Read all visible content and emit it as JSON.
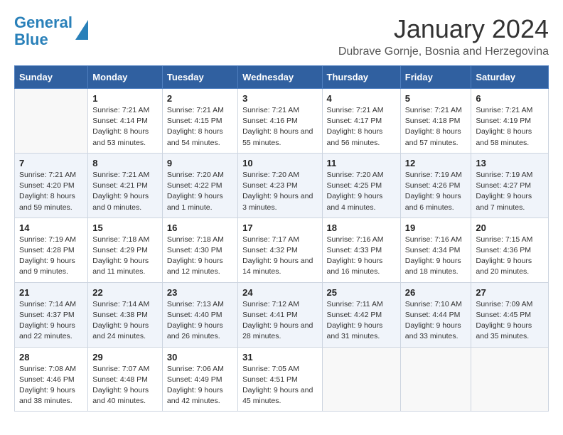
{
  "logo": {
    "line1": "General",
    "line2": "Blue"
  },
  "title": "January 2024",
  "location": "Dubrave Gornje, Bosnia and Herzegovina",
  "days_of_week": [
    "Sunday",
    "Monday",
    "Tuesday",
    "Wednesday",
    "Thursday",
    "Friday",
    "Saturday"
  ],
  "weeks": [
    [
      {
        "day": "",
        "sunrise": "",
        "sunset": "",
        "daylight": ""
      },
      {
        "day": "1",
        "sunrise": "Sunrise: 7:21 AM",
        "sunset": "Sunset: 4:14 PM",
        "daylight": "Daylight: 8 hours and 53 minutes."
      },
      {
        "day": "2",
        "sunrise": "Sunrise: 7:21 AM",
        "sunset": "Sunset: 4:15 PM",
        "daylight": "Daylight: 8 hours and 54 minutes."
      },
      {
        "day": "3",
        "sunrise": "Sunrise: 7:21 AM",
        "sunset": "Sunset: 4:16 PM",
        "daylight": "Daylight: 8 hours and 55 minutes."
      },
      {
        "day": "4",
        "sunrise": "Sunrise: 7:21 AM",
        "sunset": "Sunset: 4:17 PM",
        "daylight": "Daylight: 8 hours and 56 minutes."
      },
      {
        "day": "5",
        "sunrise": "Sunrise: 7:21 AM",
        "sunset": "Sunset: 4:18 PM",
        "daylight": "Daylight: 8 hours and 57 minutes."
      },
      {
        "day": "6",
        "sunrise": "Sunrise: 7:21 AM",
        "sunset": "Sunset: 4:19 PM",
        "daylight": "Daylight: 8 hours and 58 minutes."
      }
    ],
    [
      {
        "day": "7",
        "sunrise": "Sunrise: 7:21 AM",
        "sunset": "Sunset: 4:20 PM",
        "daylight": "Daylight: 8 hours and 59 minutes."
      },
      {
        "day": "8",
        "sunrise": "Sunrise: 7:21 AM",
        "sunset": "Sunset: 4:21 PM",
        "daylight": "Daylight: 9 hours and 0 minutes."
      },
      {
        "day": "9",
        "sunrise": "Sunrise: 7:20 AM",
        "sunset": "Sunset: 4:22 PM",
        "daylight": "Daylight: 9 hours and 1 minute."
      },
      {
        "day": "10",
        "sunrise": "Sunrise: 7:20 AM",
        "sunset": "Sunset: 4:23 PM",
        "daylight": "Daylight: 9 hours and 3 minutes."
      },
      {
        "day": "11",
        "sunrise": "Sunrise: 7:20 AM",
        "sunset": "Sunset: 4:25 PM",
        "daylight": "Daylight: 9 hours and 4 minutes."
      },
      {
        "day": "12",
        "sunrise": "Sunrise: 7:19 AM",
        "sunset": "Sunset: 4:26 PM",
        "daylight": "Daylight: 9 hours and 6 minutes."
      },
      {
        "day": "13",
        "sunrise": "Sunrise: 7:19 AM",
        "sunset": "Sunset: 4:27 PM",
        "daylight": "Daylight: 9 hours and 7 minutes."
      }
    ],
    [
      {
        "day": "14",
        "sunrise": "Sunrise: 7:19 AM",
        "sunset": "Sunset: 4:28 PM",
        "daylight": "Daylight: 9 hours and 9 minutes."
      },
      {
        "day": "15",
        "sunrise": "Sunrise: 7:18 AM",
        "sunset": "Sunset: 4:29 PM",
        "daylight": "Daylight: 9 hours and 11 minutes."
      },
      {
        "day": "16",
        "sunrise": "Sunrise: 7:18 AM",
        "sunset": "Sunset: 4:30 PM",
        "daylight": "Daylight: 9 hours and 12 minutes."
      },
      {
        "day": "17",
        "sunrise": "Sunrise: 7:17 AM",
        "sunset": "Sunset: 4:32 PM",
        "daylight": "Daylight: 9 hours and 14 minutes."
      },
      {
        "day": "18",
        "sunrise": "Sunrise: 7:16 AM",
        "sunset": "Sunset: 4:33 PM",
        "daylight": "Daylight: 9 hours and 16 minutes."
      },
      {
        "day": "19",
        "sunrise": "Sunrise: 7:16 AM",
        "sunset": "Sunset: 4:34 PM",
        "daylight": "Daylight: 9 hours and 18 minutes."
      },
      {
        "day": "20",
        "sunrise": "Sunrise: 7:15 AM",
        "sunset": "Sunset: 4:36 PM",
        "daylight": "Daylight: 9 hours and 20 minutes."
      }
    ],
    [
      {
        "day": "21",
        "sunrise": "Sunrise: 7:14 AM",
        "sunset": "Sunset: 4:37 PM",
        "daylight": "Daylight: 9 hours and 22 minutes."
      },
      {
        "day": "22",
        "sunrise": "Sunrise: 7:14 AM",
        "sunset": "Sunset: 4:38 PM",
        "daylight": "Daylight: 9 hours and 24 minutes."
      },
      {
        "day": "23",
        "sunrise": "Sunrise: 7:13 AM",
        "sunset": "Sunset: 4:40 PM",
        "daylight": "Daylight: 9 hours and 26 minutes."
      },
      {
        "day": "24",
        "sunrise": "Sunrise: 7:12 AM",
        "sunset": "Sunset: 4:41 PM",
        "daylight": "Daylight: 9 hours and 28 minutes."
      },
      {
        "day": "25",
        "sunrise": "Sunrise: 7:11 AM",
        "sunset": "Sunset: 4:42 PM",
        "daylight": "Daylight: 9 hours and 31 minutes."
      },
      {
        "day": "26",
        "sunrise": "Sunrise: 7:10 AM",
        "sunset": "Sunset: 4:44 PM",
        "daylight": "Daylight: 9 hours and 33 minutes."
      },
      {
        "day": "27",
        "sunrise": "Sunrise: 7:09 AM",
        "sunset": "Sunset: 4:45 PM",
        "daylight": "Daylight: 9 hours and 35 minutes."
      }
    ],
    [
      {
        "day": "28",
        "sunrise": "Sunrise: 7:08 AM",
        "sunset": "Sunset: 4:46 PM",
        "daylight": "Daylight: 9 hours and 38 minutes."
      },
      {
        "day": "29",
        "sunrise": "Sunrise: 7:07 AM",
        "sunset": "Sunset: 4:48 PM",
        "daylight": "Daylight: 9 hours and 40 minutes."
      },
      {
        "day": "30",
        "sunrise": "Sunrise: 7:06 AM",
        "sunset": "Sunset: 4:49 PM",
        "daylight": "Daylight: 9 hours and 42 minutes."
      },
      {
        "day": "31",
        "sunrise": "Sunrise: 7:05 AM",
        "sunset": "Sunset: 4:51 PM",
        "daylight": "Daylight: 9 hours and 45 minutes."
      },
      {
        "day": "",
        "sunrise": "",
        "sunset": "",
        "daylight": ""
      },
      {
        "day": "",
        "sunrise": "",
        "sunset": "",
        "daylight": ""
      },
      {
        "day": "",
        "sunrise": "",
        "sunset": "",
        "daylight": ""
      }
    ]
  ]
}
